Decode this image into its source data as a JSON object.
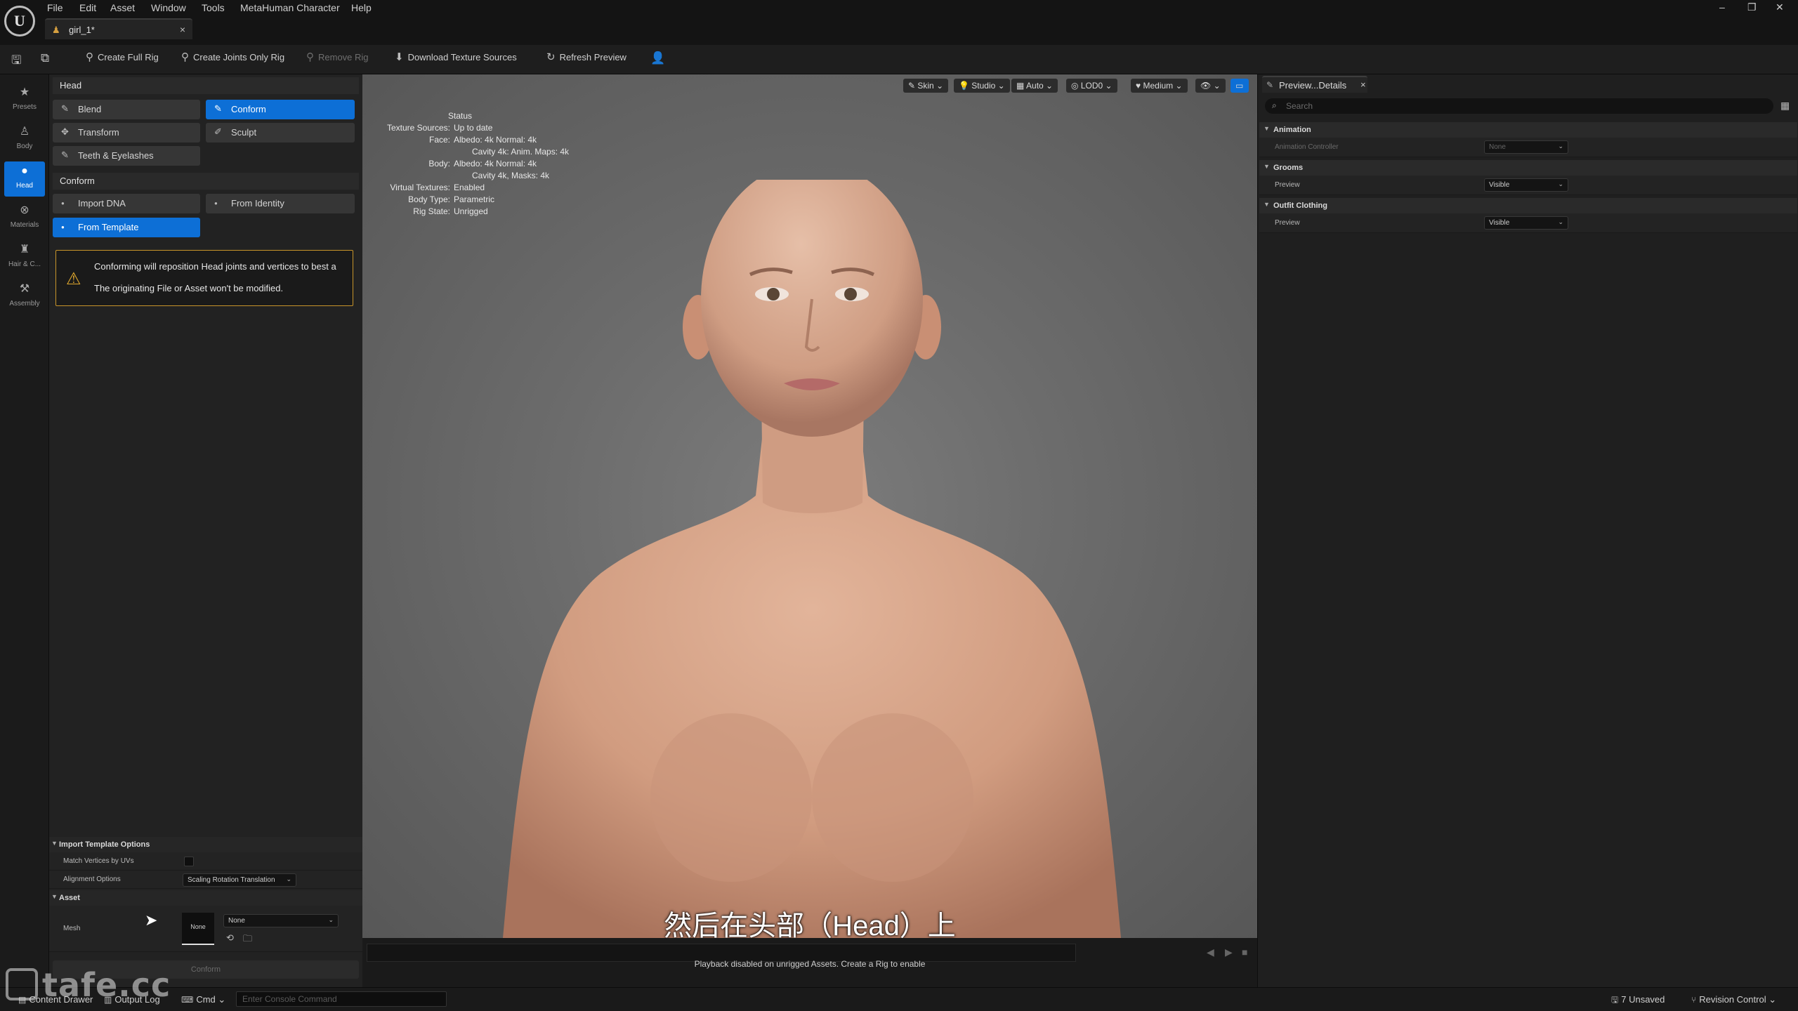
{
  "menu": {
    "items": [
      "File",
      "Edit",
      "Asset",
      "Window",
      "Tools",
      "MetaHuman Character",
      "Help"
    ]
  },
  "document_tab": {
    "title": "girl_1*",
    "close": "×"
  },
  "window_controls": {
    "minimize": "–",
    "restore": "❐",
    "close": "✕"
  },
  "toolbar": {
    "create_full_rig": "Create Full Rig",
    "create_joints_only_rig": "Create Joints Only Rig",
    "remove_rig": "Remove Rig",
    "download_texture_sources": "Download Texture Sources",
    "refresh_preview": "Refresh Preview"
  },
  "sidebar": {
    "items": [
      {
        "label": "Presets",
        "icon": "star-icon"
      },
      {
        "label": "Body",
        "icon": "body-icon"
      },
      {
        "label": "Head",
        "icon": "head-icon",
        "active": true
      },
      {
        "label": "Materials",
        "icon": "materials-icon"
      },
      {
        "label": "Hair & C...",
        "icon": "hair-icon"
      },
      {
        "label": "Assembly",
        "icon": "assembly-icon"
      }
    ]
  },
  "left_panel": {
    "head_section": "Head",
    "blend": "Blend",
    "conform_tool": "Conform",
    "transform": "Transform",
    "sculpt": "Sculpt",
    "teeth_eyelashes": "Teeth & Eyelashes",
    "conform_section": "Conform",
    "import_dna": "Import DNA",
    "from_identity": "From Identity",
    "from_template": "From Template",
    "warning_line1": "Conforming will reposition Head joints and vertices to best a",
    "warning_line2": "The originating File or Asset won't be modified.",
    "import_template_options": "Import Template Options",
    "match_vertices_by_uvs": "Match Vertices by UVs",
    "match_vertices_checked": false,
    "alignment_options": "Alignment Options",
    "alignment_value": "Scaling Rotation Translation",
    "asset_section": "Asset",
    "mesh_label": "Mesh",
    "mesh_thumb": "None",
    "mesh_value": "None",
    "conform_button": "Conform"
  },
  "viewport": {
    "chips": [
      "Skin",
      "Studio",
      "Auto",
      "LOD0",
      "Medium"
    ],
    "status": {
      "title": "Status",
      "rows": [
        {
          "k": "Texture Sources:",
          "v": "Up to date"
        },
        {
          "k": "Face:",
          "v": "Albedo: 4k Normal: 4k"
        },
        {
          "k": "",
          "v": "Cavity 4k: Anim. Maps: 4k"
        },
        {
          "k": "Body:",
          "v": "Albedo: 4k Normal: 4k"
        },
        {
          "k": "",
          "v": "Cavity 4k, Masks: 4k"
        },
        {
          "k": "Virtual Textures:",
          "v": "Enabled"
        },
        {
          "k": "Body Type:",
          "v": "Parametric"
        },
        {
          "k": "Rig State:",
          "v": "Unrigged"
        }
      ]
    },
    "subtitle": "然后在头部（Head）上",
    "playback_note": "Playback disabled on unrigged Assets. Create a Rig to enable"
  },
  "right_panel": {
    "tab_title": "Preview...Details",
    "search_placeholder": "Search",
    "sections": {
      "animation": "Animation",
      "animation_controller": "Animation Controller",
      "animation_controller_value": "None",
      "grooms": "Grooms",
      "grooms_preview": "Preview",
      "grooms_preview_value": "Visible",
      "outfit_clothing": "Outfit Clothing",
      "outfit_preview": "Preview",
      "outfit_preview_value": "Visible"
    }
  },
  "statusbar": {
    "content_drawer": "Content Drawer",
    "output_log": "Output Log",
    "cmd": "Cmd",
    "console_placeholder": "Enter Console Command",
    "unsaved": "7 Unsaved",
    "revision_control": "Revision Control"
  },
  "watermark": "tafe.cc",
  "colors": {
    "accent": "#0d6fd6",
    "warning": "#e0a82e",
    "panel": "#222222",
    "viewport_bg": "#6c6c6c",
    "skin": "#d8a78b"
  }
}
